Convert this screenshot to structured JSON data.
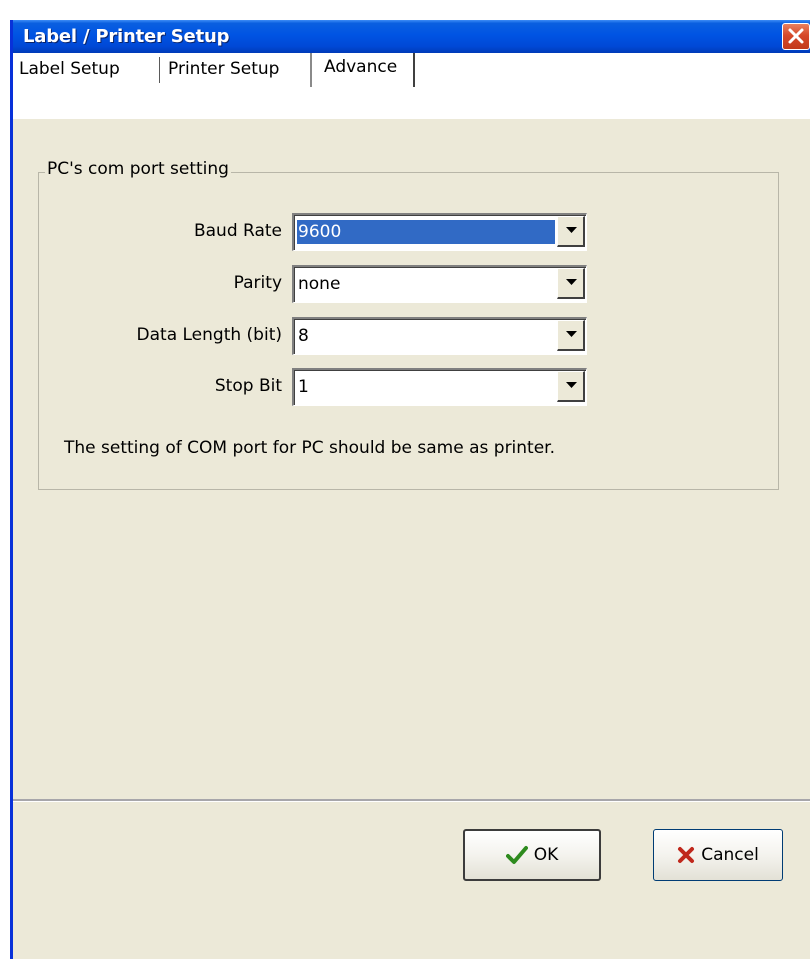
{
  "window": {
    "title": "Label / Printer Setup"
  },
  "tabs": [
    {
      "label": "Label Setup"
    },
    {
      "label": "Printer Setup"
    },
    {
      "label": "Advance",
      "active": true
    }
  ],
  "group": {
    "legend": "PC's com port setting",
    "fields": [
      {
        "label": "Baud Rate",
        "value": "9600",
        "selected": true
      },
      {
        "label": "Parity",
        "value": "none"
      },
      {
        "label": "Data Length (bit)",
        "value": "8"
      },
      {
        "label": "Stop Bit",
        "value": "1"
      }
    ],
    "note": "The setting of COM port for PC should be same as printer."
  },
  "buttons": {
    "ok_label": "OK",
    "cancel_label": "Cancel"
  },
  "icons": {
    "close": "close-icon",
    "dropdown": "chevron-down-icon",
    "ok": "checkmark-icon",
    "cancel": "x-mark-icon"
  },
  "colors": {
    "titlebar": "#0054e3",
    "selection": "#316ac5",
    "dialog_bg": "#ece9d8",
    "close_button": "#d6492a",
    "ok_check": "#2e8b1e",
    "cancel_x": "#c0281c"
  }
}
